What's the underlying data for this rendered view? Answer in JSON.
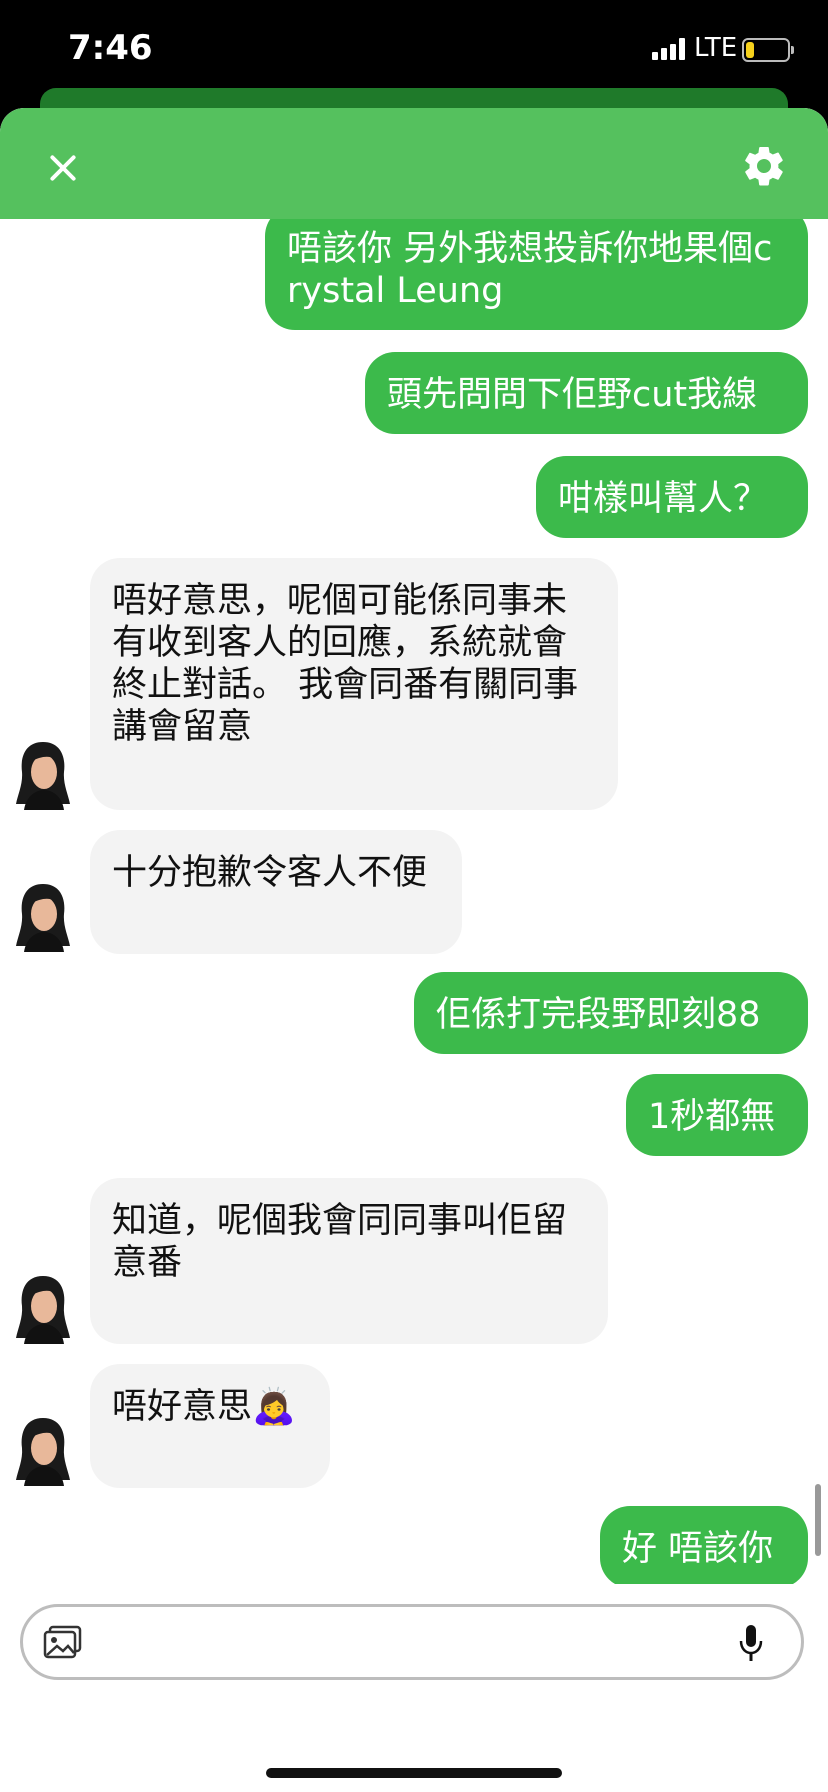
{
  "status_bar": {
    "time": "7:46",
    "network": "LTE",
    "battery_level": 0.2
  },
  "header": {
    "close_icon": "close-icon",
    "settings_icon": "gear-icon",
    "color": "#55c15e"
  },
  "messages": [
    {
      "side": "out",
      "text": "唔該你 另外我想投訴你地果個crystal Leung"
    },
    {
      "side": "out",
      "text": "頭先問問下佢野cut我線"
    },
    {
      "side": "out",
      "text": "咁樣叫幫人？"
    },
    {
      "side": "in",
      "text": "唔好意思，呢個可能係同事未有收到客人的回應，系統就會終止對話。 我會同番有關同事講會留意"
    },
    {
      "side": "in",
      "text": "十分抱歉令客人不便"
    },
    {
      "side": "out",
      "text": "佢係打完段野即刻88"
    },
    {
      "side": "out",
      "text": "1秒都無"
    },
    {
      "side": "in",
      "text": "知道，呢個我會同同事叫佢留意番"
    },
    {
      "side": "in",
      "text": "唔好意思🙇‍♀️"
    },
    {
      "side": "out",
      "text": "好 唔該你"
    }
  ],
  "composer": {
    "placeholder": "",
    "photo_icon": "photo-icon",
    "mic_icon": "microphone-icon"
  },
  "colors": {
    "outgoing": "#3cba4b",
    "incoming": "#f3f3f3"
  }
}
